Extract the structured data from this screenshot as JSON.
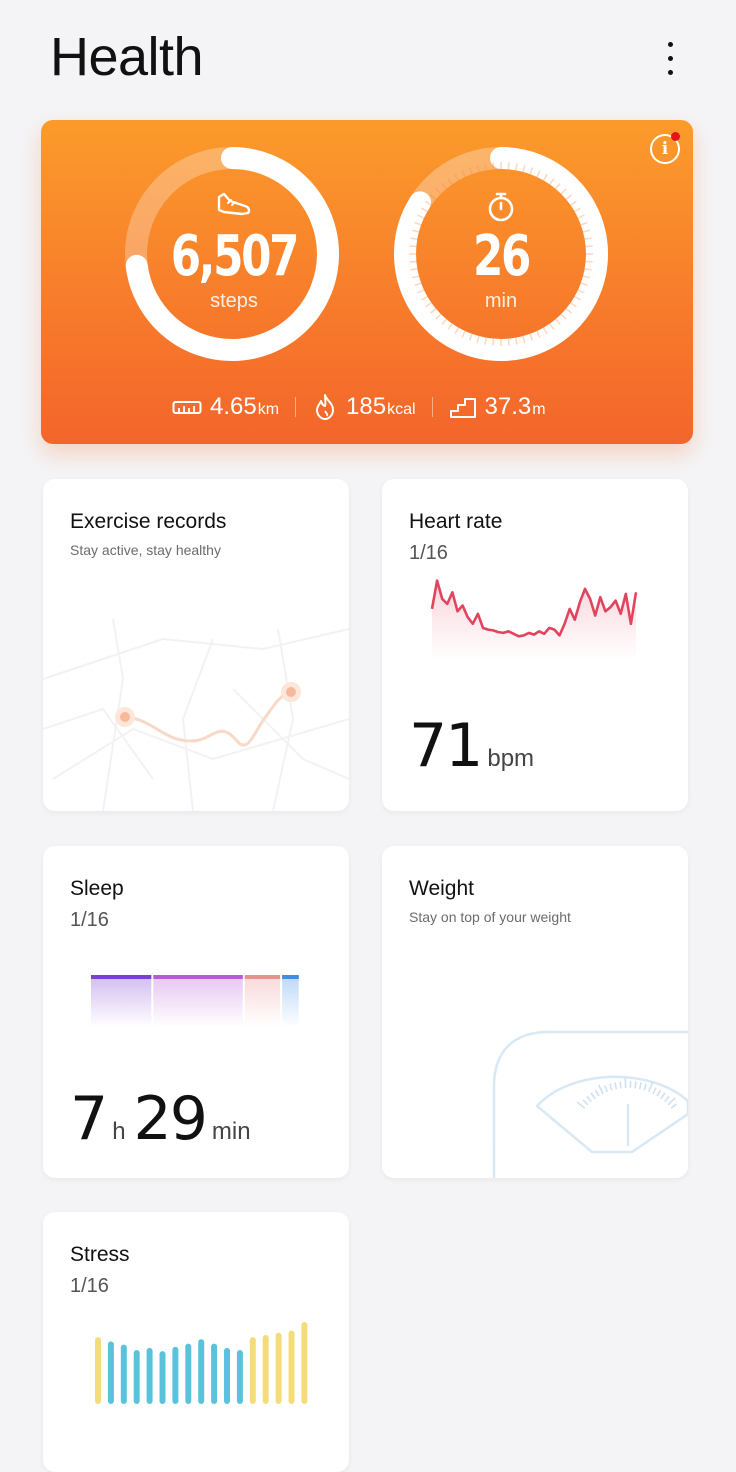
{
  "header": {
    "title": "Health"
  },
  "activity": {
    "steps": {
      "value": "6,507",
      "unit": "steps",
      "progress": 0.73
    },
    "active_time": {
      "value": "26",
      "unit": "min",
      "progress": 0.84
    },
    "stats": [
      {
        "icon": "ruler-icon",
        "value": "4.65",
        "unit": "km"
      },
      {
        "icon": "flame-icon",
        "value": "185",
        "unit": "kcal"
      },
      {
        "icon": "stairs-icon",
        "value": "37.3",
        "unit": "m"
      }
    ],
    "colors": {
      "top": "#fb9b2b",
      "bottom": "#f3652b",
      "notification": "#e6141e"
    }
  },
  "cards": {
    "exercise": {
      "title": "Exercise records",
      "subtitle": "Stay active, stay healthy"
    },
    "heart": {
      "title": "Heart rate",
      "date": "1/16",
      "value": "71",
      "unit": "bpm",
      "color": "#e1445f",
      "trend": [
        58,
        92,
        70,
        64,
        78,
        55,
        62,
        48,
        40,
        52,
        35,
        33,
        32,
        30,
        29,
        31,
        28,
        25,
        26,
        29,
        27,
        31,
        28,
        35,
        33,
        26,
        40,
        58,
        45,
        66,
        82,
        70,
        50,
        72,
        55,
        60,
        68,
        52,
        76,
        40,
        78
      ]
    },
    "sleep": {
      "title": "Sleep",
      "date": "1/16",
      "hours": "7",
      "hours_unit": "h",
      "minutes": "29",
      "minutes_unit": "min",
      "stages": [
        {
          "stage": "deep",
          "share": 0.29,
          "color": "#7b3fd4"
        },
        {
          "stage": "light",
          "share": 0.43,
          "color": "#b85ad8"
        },
        {
          "stage": "rem",
          "share": 0.17,
          "color": "#ea9290"
        },
        {
          "stage": "awake",
          "share": 0.08,
          "color": "#3e8fe3"
        }
      ]
    },
    "weight": {
      "title": "Weight",
      "subtitle": "Stay on top of your weight"
    },
    "stress": {
      "title": "Stress",
      "date": "1/16",
      "levels": [
        62,
        58,
        55,
        50,
        52,
        49,
        53,
        56,
        60,
        56,
        52,
        50,
        62,
        64,
        66,
        68,
        76
      ],
      "color_low": "#59c3dc",
      "color_mid": "#f5dc7a"
    }
  }
}
